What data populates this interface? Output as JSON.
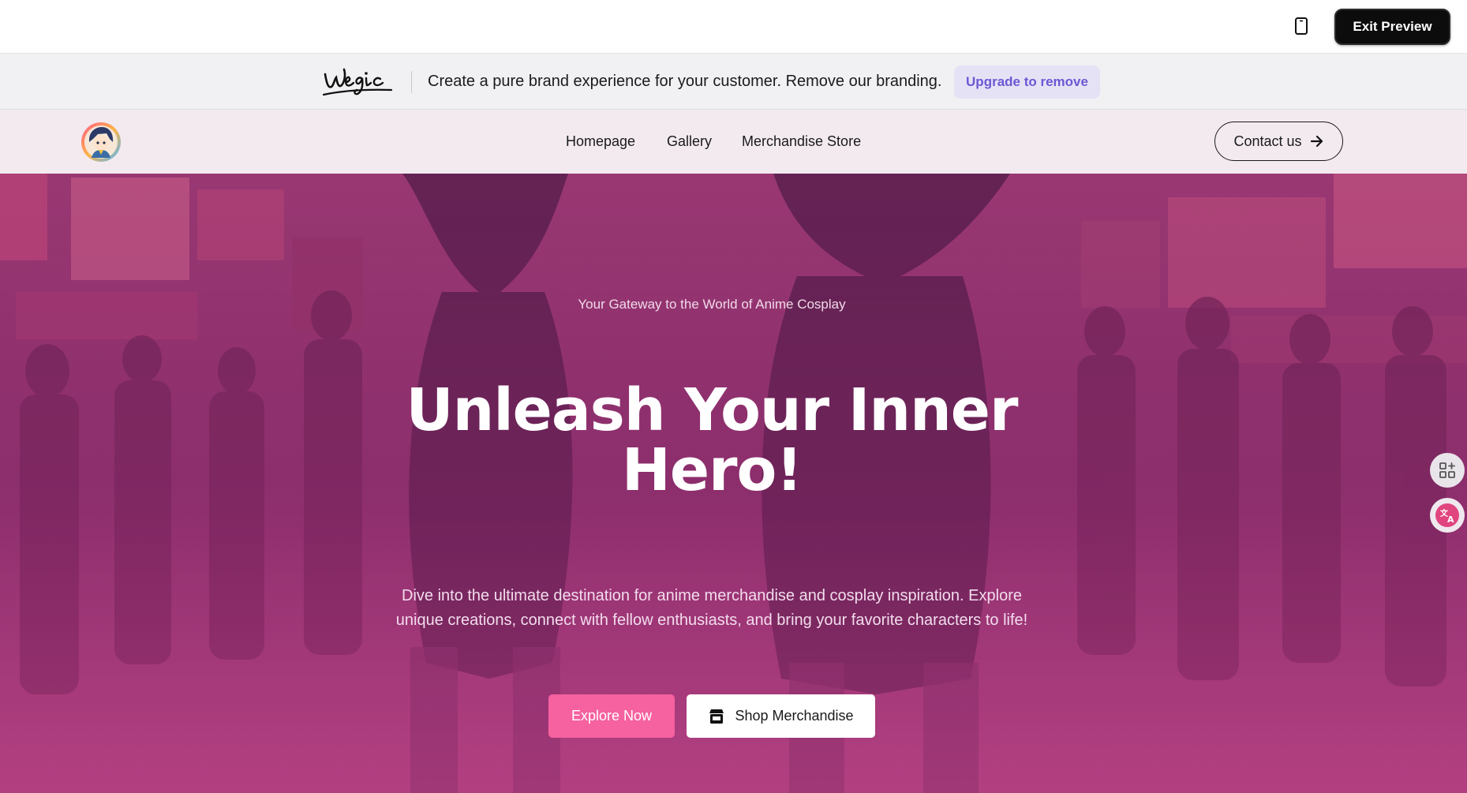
{
  "preview_bar": {
    "device_icon": "mobile-device-icon",
    "exit_label": "Exit Preview"
  },
  "branding_bar": {
    "logo_text": "wegic",
    "message": "Create a pure brand experience for your customer. Remove our branding.",
    "upgrade_label": "Upgrade to remove",
    "accent_color": "#6c58d4"
  },
  "nav": {
    "links": [
      {
        "label": "Homepage"
      },
      {
        "label": "Gallery"
      },
      {
        "label": "Merchandise Store"
      }
    ],
    "contact_label": "Contact us",
    "contact_icon": "arrow-right-icon"
  },
  "hero": {
    "subtitle": "Your Gateway to the World of Anime Cosplay",
    "title_line1": "Unleash Your Inner",
    "title_line2": "Hero!",
    "description_line1": "Dive into the ultimate destination for anime merchandise and cosplay inspiration. Explore",
    "description_line2": "unique creations, connect with fellow enthusiasts, and bring your favorite characters to life!",
    "primary_button": "Explore Now",
    "secondary_button": "Shop Merchandise",
    "secondary_icon": "store-icon",
    "primary_color": "#f6619f"
  },
  "side_tools": [
    {
      "icon": "add-widget-icon"
    },
    {
      "icon": "translate-icon"
    }
  ]
}
